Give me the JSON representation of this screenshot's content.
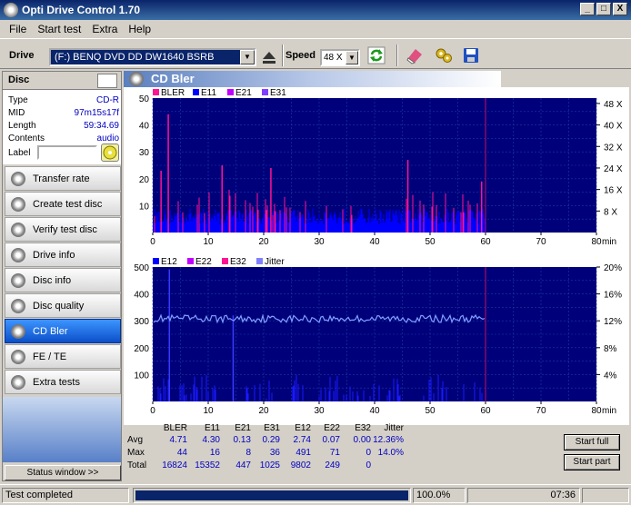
{
  "window": {
    "title": "Opti Drive Control 1.70",
    "minimize": "_",
    "maximize": "□",
    "close": "X"
  },
  "menu": [
    "File",
    "Start test",
    "Extra",
    "Help"
  ],
  "toolbar": {
    "drive_label": "Drive",
    "drive_value": "(F:)   BENQ DVD DD DW1640 BSRB",
    "speed_label": "Speed",
    "speed_value": "48 X"
  },
  "disc": {
    "header": "Disc",
    "fields": [
      {
        "label": "Type",
        "value": "CD-R"
      },
      {
        "label": "MID",
        "value": "97m15s17f"
      },
      {
        "label": "Length",
        "value": "59:34.69"
      },
      {
        "label": "Contents",
        "value": "audio"
      }
    ],
    "label_field": "Label"
  },
  "nav": [
    "Transfer rate",
    "Create test disc",
    "Verify test disc",
    "Drive info",
    "Disc info",
    "Disc quality",
    "CD Bler",
    "FE / TE",
    "Extra tests"
  ],
  "nav_active": "CD Bler",
  "status_window_button": "Status window >>",
  "panel_title": "CD Bler",
  "chart_data": [
    {
      "type": "bar",
      "legend": [
        {
          "name": "BLER",
          "color": "#ff1493"
        },
        {
          "name": "E11",
          "color": "#0000ff"
        },
        {
          "name": "E21",
          "color": "#c000ff"
        },
        {
          "name": "E31",
          "color": "#8040ff"
        }
      ],
      "xlabel": "min",
      "xlim": [
        0,
        80
      ],
      "xticks": [
        "0",
        "10",
        "20",
        "30",
        "40",
        "50",
        "60",
        "70",
        "80"
      ],
      "ylim": [
        0,
        50
      ],
      "yticks": [
        "10",
        "20",
        "30",
        "40",
        "50"
      ],
      "y2ticks": [
        "8 X",
        "16 X",
        "24 X",
        "32 X",
        "40 X",
        "48 X"
      ],
      "data_end_min": 59.6,
      "peaks": [
        {
          "x": 2.8,
          "y": 44
        },
        {
          "x": 1.5,
          "y": 23
        },
        {
          "x": 12.5,
          "y": 25
        },
        {
          "x": 21.3,
          "y": 24
        },
        {
          "x": 46,
          "y": 27
        },
        {
          "x": 59.3,
          "y": 19
        }
      ]
    },
    {
      "type": "bar",
      "legend": [
        {
          "name": "E12",
          "color": "#0000ff"
        },
        {
          "name": "E22",
          "color": "#c000ff"
        },
        {
          "name": "E32",
          "color": "#ff1493"
        },
        {
          "name": "Jitter",
          "color": "#8080ff"
        }
      ],
      "xlabel": "min",
      "xlim": [
        0,
        80
      ],
      "xticks": [
        "0",
        "10",
        "20",
        "30",
        "40",
        "50",
        "60",
        "70",
        "80"
      ],
      "ylim": [
        0,
        500
      ],
      "yticks": [
        "100",
        "200",
        "300",
        "400",
        "500"
      ],
      "y2ticks": [
        "4%",
        "8%",
        "12%",
        "16%",
        "20%"
      ],
      "jitter_avg_percent": 12.36,
      "jitter_max_percent": 14.0,
      "peaks": [
        {
          "x": 3.0,
          "y": 491
        },
        {
          "x": 14.5,
          "y": 320
        }
      ]
    }
  ],
  "stats": {
    "headers": [
      "BLER",
      "E11",
      "E21",
      "E31",
      "E12",
      "E22",
      "E32",
      "Jitter"
    ],
    "rows": [
      {
        "label": "Avg",
        "values": [
          "4.71",
          "4.30",
          "0.13",
          "0.29",
          "2.74",
          "0.07",
          "0.00",
          "12.36%"
        ]
      },
      {
        "label": "Max",
        "values": [
          "44",
          "16",
          "8",
          "36",
          "491",
          "71",
          "0",
          "14.0%"
        ]
      },
      {
        "label": "Total",
        "values": [
          "16824",
          "15352",
          "447",
          "1025",
          "9802",
          "249",
          "0",
          ""
        ]
      }
    ]
  },
  "buttons": {
    "start_full": "Start full",
    "start_part": "Start part"
  },
  "statusbar": {
    "text": "Test completed",
    "progress_percent": 100,
    "progress_text": "100.0%",
    "time": "07:36"
  }
}
